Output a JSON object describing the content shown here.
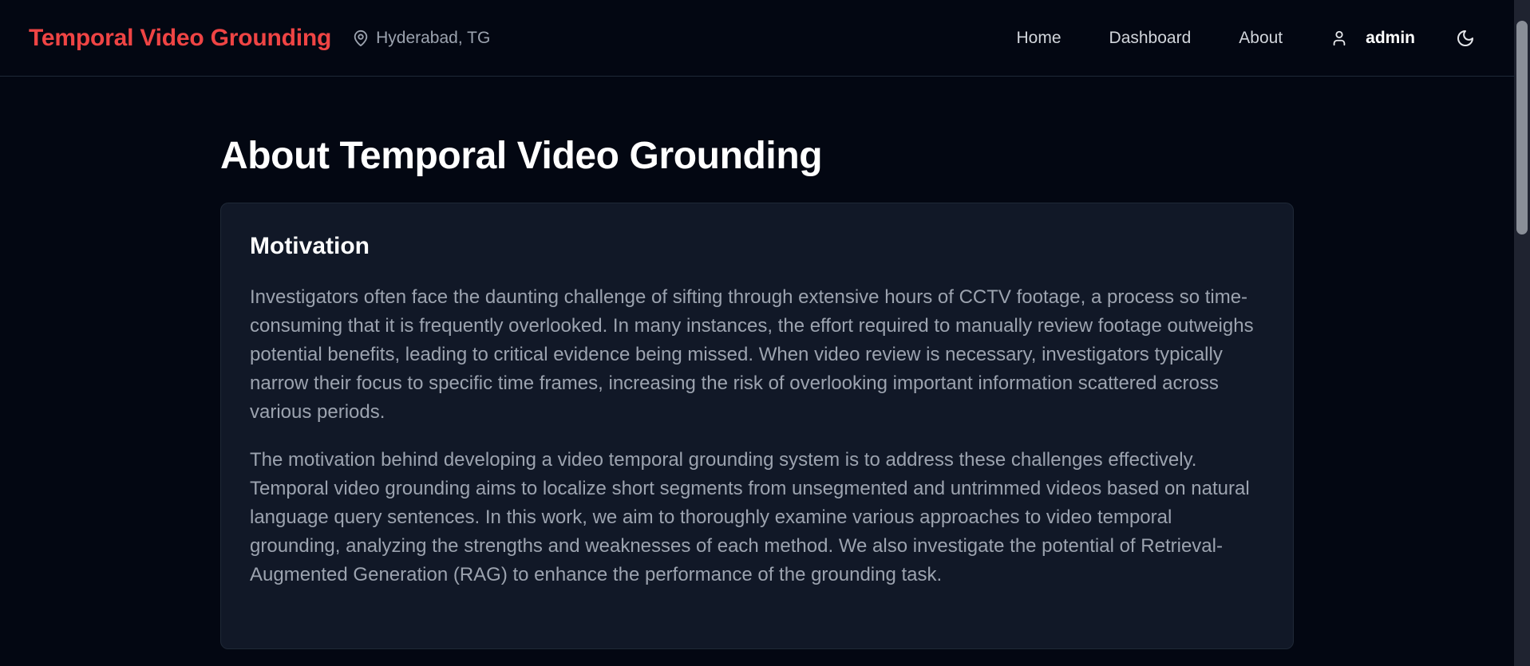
{
  "header": {
    "brand": "Temporal Video Grounding",
    "location": "Hyderabad, TG",
    "location_icon": "map-pin-icon",
    "nav": [
      {
        "label": "Home"
      },
      {
        "label": "Dashboard"
      },
      {
        "label": "About"
      }
    ],
    "user_icon": "user-icon",
    "username": "admin",
    "theme_icon": "moon-icon"
  },
  "main": {
    "title": "About Temporal Video Grounding",
    "section": {
      "title": "Motivation",
      "paragraphs": [
        "Investigators often face the daunting challenge of sifting through extensive hours of CCTV footage, a process so time-consuming that it is frequently overlooked. In many instances, the effort required to manually review footage outweighs potential benefits, leading to critical evidence being missed. When video review is necessary, investigators typically narrow their focus to specific time frames, increasing the risk of overlooking important information scattered across various periods.",
        "The motivation behind developing a video temporal grounding system is to address these challenges effectively. Temporal video grounding aims to localize short segments from unsegmented and untrimmed videos based on natural language query sentences. In this work, we aim to thoroughly examine various approaches to video temporal grounding, analyzing the strengths and weaknesses of each method. We also investigate the potential of Retrieval-Augmented Generation (RAG) to enhance the performance of the grounding task."
      ]
    }
  },
  "colors": {
    "background": "#030712",
    "brand": "#ef4444",
    "card": "#111827",
    "text_muted": "#9ca3af"
  }
}
